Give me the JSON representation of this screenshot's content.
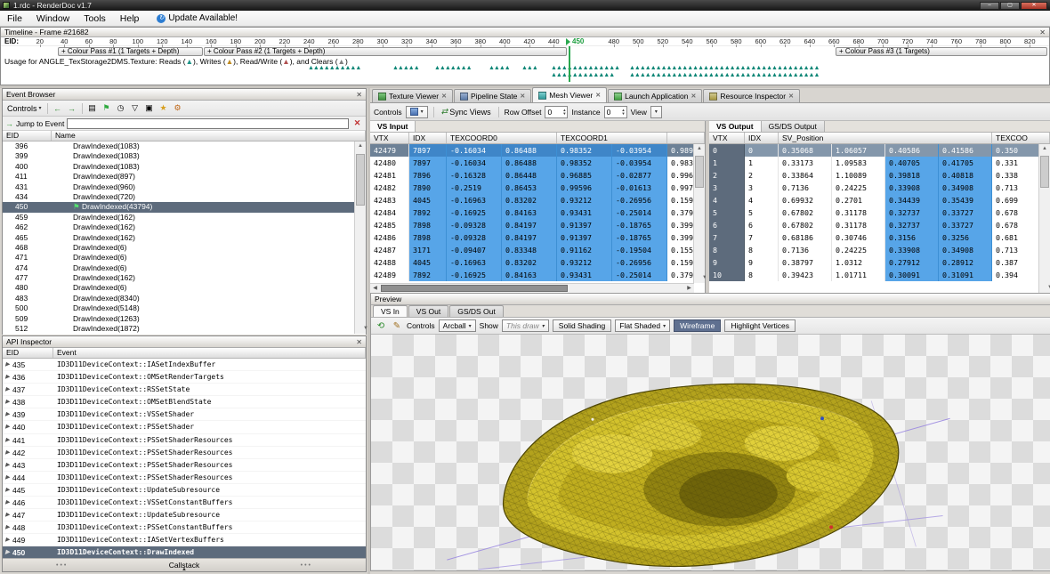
{
  "window": {
    "title": "1.rdc - RenderDoc v1.7"
  },
  "icons": {
    "minimize": "–",
    "maximize": "▢",
    "close": "✕",
    "panel_close": "✕",
    "update": "↻",
    "dropdown": "▾",
    "back": "←",
    "forward": "→",
    "export": "▤",
    "flag": "⚑",
    "clock": "◷",
    "filter": "▽",
    "save": "▣",
    "star": "★",
    "gear": "⚙",
    "jump": "→",
    "clear": "✕",
    "expand": "▶",
    "spin_up": "▴",
    "spin_down": "▾",
    "sync": "⇄",
    "tab_close": "✕",
    "scroll_up": "▲",
    "scroll_down": "▼",
    "scroll_left": "◀",
    "scroll_right": "▶",
    "reset_camera": "⟲",
    "edit": "✎",
    "handle_dots": "•••",
    "collapse_up": "▲"
  },
  "menu": {
    "items": [
      "File",
      "Window",
      "Tools",
      "Help"
    ],
    "update_label": "Update Available!"
  },
  "timeline": {
    "title": "Timeline - Frame #21682",
    "eid_label": "EID:",
    "ticks_before": [
      "20",
      "40",
      "60",
      "80",
      "100",
      "120",
      "140",
      "160",
      "180",
      "200",
      "220",
      "240",
      "260",
      "280",
      "300",
      "320",
      "340",
      "360",
      "380",
      "400",
      "420",
      "440"
    ],
    "marker": "450",
    "ticks_after": [
      "480",
      "500",
      "520",
      "540",
      "560",
      "580",
      "600",
      "620",
      "640",
      "660",
      "680",
      "700",
      "720",
      "740",
      "760",
      "780",
      "800",
      "820"
    ],
    "passes": [
      "+ Colour Pass #1 (1 Targets + Depth)",
      "+ Colour Pass #2 (1 Targets + Depth)",
      "+ Colour Pass #3 (1 Targets)"
    ],
    "usage": {
      "s1": "Usage for ANGLE_TexStorage2DMS.Texture: Reads (",
      "tri": "▲",
      "s2": "), Writes (",
      "s3": "), Read/Write (",
      "s4": "), and Clears (",
      "s5": ")"
    },
    "marker_rows": {
      "row1": [
        {
          "glyphs": "▲▲▲▲▲▲▲▲▲▲"
        },
        {
          "glyphs": "▲▲▲▲▲"
        },
        {
          "glyphs": "▲▲▲▲▲▲▲"
        },
        {
          "glyphs": "▲▲▲▲"
        },
        {
          "glyphs": "▲▲▲"
        },
        {
          "glyphs": "▲▲▲▲▲▲▲▲▲▲▲▲▲"
        },
        {
          "glyphs": "▲▲▲▲▲▲▲▲▲▲▲▲▲▲▲▲▲▲▲▲▲▲▲▲▲▲▲▲▲▲▲▲▲▲▲▲"
        }
      ],
      "row2": [
        {
          "glyphs": "▲▲▲▲▲▲▲▲▲▲▲▲"
        },
        {
          "glyphs": "▲▲▲▲▲▲▲▲▲▲▲▲▲▲▲▲▲▲▲▲▲▲▲▲▲▲▲▲▲▲▲▲▲▲▲▲"
        }
      ]
    }
  },
  "event_browser": {
    "title": "Event Browser",
    "controls_label": "Controls",
    "jump_label": "Jump to Event",
    "columns": [
      "EID",
      "Name"
    ],
    "rows": [
      {
        "eid": "396",
        "name": "DrawIndexed(1083)"
      },
      {
        "eid": "399",
        "name": "DrawIndexed(1083)"
      },
      {
        "eid": "400",
        "name": "DrawIndexed(1083)"
      },
      {
        "eid": "411",
        "name": "DrawIndexed(897)"
      },
      {
        "eid": "431",
        "name": "DrawIndexed(960)"
      },
      {
        "eid": "434",
        "name": "DrawIndexed(720)"
      },
      {
        "eid": "450",
        "name": "DrawIndexed(43794)",
        "selected": true
      },
      {
        "eid": "459",
        "name": "DrawIndexed(162)"
      },
      {
        "eid": "462",
        "name": "DrawIndexed(162)"
      },
      {
        "eid": "465",
        "name": "DrawIndexed(162)"
      },
      {
        "eid": "468",
        "name": "DrawIndexed(6)"
      },
      {
        "eid": "471",
        "name": "DrawIndexed(6)"
      },
      {
        "eid": "474",
        "name": "DrawIndexed(6)"
      },
      {
        "eid": "477",
        "name": "DrawIndexed(162)"
      },
      {
        "eid": "480",
        "name": "DrawIndexed(6)"
      },
      {
        "eid": "483",
        "name": "DrawIndexed(8340)"
      },
      {
        "eid": "500",
        "name": "DrawIndexed(5148)"
      },
      {
        "eid": "509",
        "name": "DrawIndexed(1263)"
      },
      {
        "eid": "512",
        "name": "DrawIndexed(1872)"
      }
    ]
  },
  "api_inspector": {
    "title": "API Inspector",
    "columns": [
      "EID",
      "Event"
    ],
    "callstack_label": "Callstack",
    "rows": [
      {
        "eid": "435",
        "event": "ID3D11DeviceContext::IASetIndexBuffer"
      },
      {
        "eid": "436",
        "event": "ID3D11DeviceContext::OMSetRenderTargets"
      },
      {
        "eid": "437",
        "event": "ID3D11DeviceContext::RSSetState"
      },
      {
        "eid": "438",
        "event": "ID3D11DeviceContext::OMSetBlendState"
      },
      {
        "eid": "439",
        "event": "ID3D11DeviceContext::VSSetShader"
      },
      {
        "eid": "440",
        "event": "ID3D11DeviceContext::PSSetShader"
      },
      {
        "eid": "441",
        "event": "ID3D11DeviceContext::PSSetShaderResources"
      },
      {
        "eid": "442",
        "event": "ID3D11DeviceContext::PSSetShaderResources"
      },
      {
        "eid": "443",
        "event": "ID3D11DeviceContext::PSSetShaderResources"
      },
      {
        "eid": "444",
        "event": "ID3D11DeviceContext::PSSetShaderResources"
      },
      {
        "eid": "445",
        "event": "ID3D11DeviceContext::UpdateSubresource"
      },
      {
        "eid": "446",
        "event": "ID3D11DeviceContext::VSSetConstantBuffers"
      },
      {
        "eid": "447",
        "event": "ID3D11DeviceContext::UpdateSubresource"
      },
      {
        "eid": "448",
        "event": "ID3D11DeviceContext::PSSetConstantBuffers"
      },
      {
        "eid": "449",
        "event": "ID3D11DeviceContext::IASetVertexBuffers"
      },
      {
        "eid": "450",
        "event": "ID3D11DeviceContext::DrawIndexed",
        "selected": true
      }
    ]
  },
  "tabs": {
    "texture_viewer": "Texture Viewer",
    "pipeline_state": "Pipeline State",
    "mesh_viewer": "Mesh Viewer",
    "launch_application": "Launch Application",
    "resource_inspector": "Resource Inspector"
  },
  "mesh_toolbar": {
    "controls_label": "Controls",
    "sync_label": "Sync Views",
    "row_offset_label": "Row Offset",
    "row_offset_value": "0",
    "instance_label": "Instance",
    "instance_value": "0",
    "view_label": "View"
  },
  "vs_input": {
    "tab": "VS Input",
    "headers": {
      "vtx": "VTX",
      "idx": "IDX",
      "a0": "TEXCOORD0",
      "a1": "TEXCOORD1",
      "a2": ""
    },
    "rows": [
      {
        "cells": [
          "42479",
          "7897",
          "-0.16034",
          "0.86488",
          "0.98352",
          "-0.03954",
          "0.989"
        ],
        "selected": true
      },
      {
        "cells": [
          "42480",
          "7897",
          "-0.16034",
          "0.86488",
          "0.98352",
          "-0.03954",
          "0.983"
        ]
      },
      {
        "cells": [
          "42481",
          "7896",
          "-0.16328",
          "0.86448",
          "0.96885",
          "-0.02877",
          "0.996"
        ]
      },
      {
        "cells": [
          "42482",
          "7890",
          "-0.2519",
          "0.86453",
          "0.99596",
          "-0.01613",
          "0.997"
        ]
      },
      {
        "cells": [
          "42483",
          "4045",
          "-0.16963",
          "0.83202",
          "0.93212",
          "-0.26956",
          "0.159"
        ]
      },
      {
        "cells": [
          "42484",
          "7892",
          "-0.16925",
          "0.84163",
          "0.93431",
          "-0.25014",
          "0.379"
        ]
      },
      {
        "cells": [
          "42485",
          "7898",
          "-0.09328",
          "0.84197",
          "0.91397",
          "-0.18765",
          "0.399"
        ]
      },
      {
        "cells": [
          "42486",
          "7898",
          "-0.09328",
          "0.84197",
          "0.91397",
          "-0.18765",
          "0.399"
        ]
      },
      {
        "cells": [
          "42487",
          "3171",
          "-0.09407",
          "0.83348",
          "0.91162",
          "-0.19504",
          "0.155"
        ]
      },
      {
        "cells": [
          "42488",
          "4045",
          "-0.16963",
          "0.83202",
          "0.93212",
          "-0.26956",
          "0.159"
        ]
      },
      {
        "cells": [
          "42489",
          "7892",
          "-0.16925",
          "0.84163",
          "0.93431",
          "-0.25014",
          "0.379"
        ]
      }
    ]
  },
  "vs_output": {
    "tabs": [
      "VS Output",
      "GS/DS Output"
    ],
    "headers": {
      "vtx": "VTX",
      "idx": "IDX",
      "a0": "SV_Position",
      "a2": "TEXCOO"
    },
    "rows": [
      {
        "cells": [
          "0",
          "0",
          "0.35068",
          "1.06057",
          "0.40586",
          "0.41586",
          "0.350"
        ],
        "selected": true
      },
      {
        "cells": [
          "1",
          "1",
          "0.33173",
          "1.09583",
          "0.40705",
          "0.41705",
          "0.331"
        ]
      },
      {
        "cells": [
          "2",
          "2",
          "0.33864",
          "1.10089",
          "0.39818",
          "0.40818",
          "0.338"
        ]
      },
      {
        "cells": [
          "3",
          "3",
          "0.7136",
          "0.24225",
          "0.33908",
          "0.34908",
          "0.713"
        ]
      },
      {
        "cells": [
          "4",
          "4",
          "0.69932",
          "0.2701",
          "0.34439",
          "0.35439",
          "0.699"
        ]
      },
      {
        "cells": [
          "5",
          "5",
          "0.67802",
          "0.31178",
          "0.32737",
          "0.33727",
          "0.678"
        ]
      },
      {
        "cells": [
          "6",
          "6",
          "0.67802",
          "0.31178",
          "0.32737",
          "0.33727",
          "0.678"
        ]
      },
      {
        "cells": [
          "7",
          "7",
          "0.68186",
          "0.30746",
          "0.3156",
          "0.3256",
          "0.681"
        ]
      },
      {
        "cells": [
          "8",
          "8",
          "0.7136",
          "0.24225",
          "0.33908",
          "0.34908",
          "0.713"
        ]
      },
      {
        "cells": [
          "9",
          "9",
          "0.38797",
          "1.0312",
          "0.27912",
          "0.28912",
          "0.387"
        ]
      },
      {
        "cells": [
          "10",
          "8",
          "0.39423",
          "1.01711",
          "0.30091",
          "0.31091",
          "0.394"
        ]
      }
    ]
  },
  "preview": {
    "title": "Preview",
    "tabs": [
      "VS In",
      "VS Out",
      "GS/DS Out"
    ],
    "controls_label": "Controls",
    "camera_value": "Arcball",
    "show_label": "Show",
    "show_value": "This draw",
    "shading_label": "Solid Shading",
    "shading_value": "Flat Shaded",
    "wireframe_label": "Wireframe",
    "highlight_label": "Highlight Vertices"
  }
}
